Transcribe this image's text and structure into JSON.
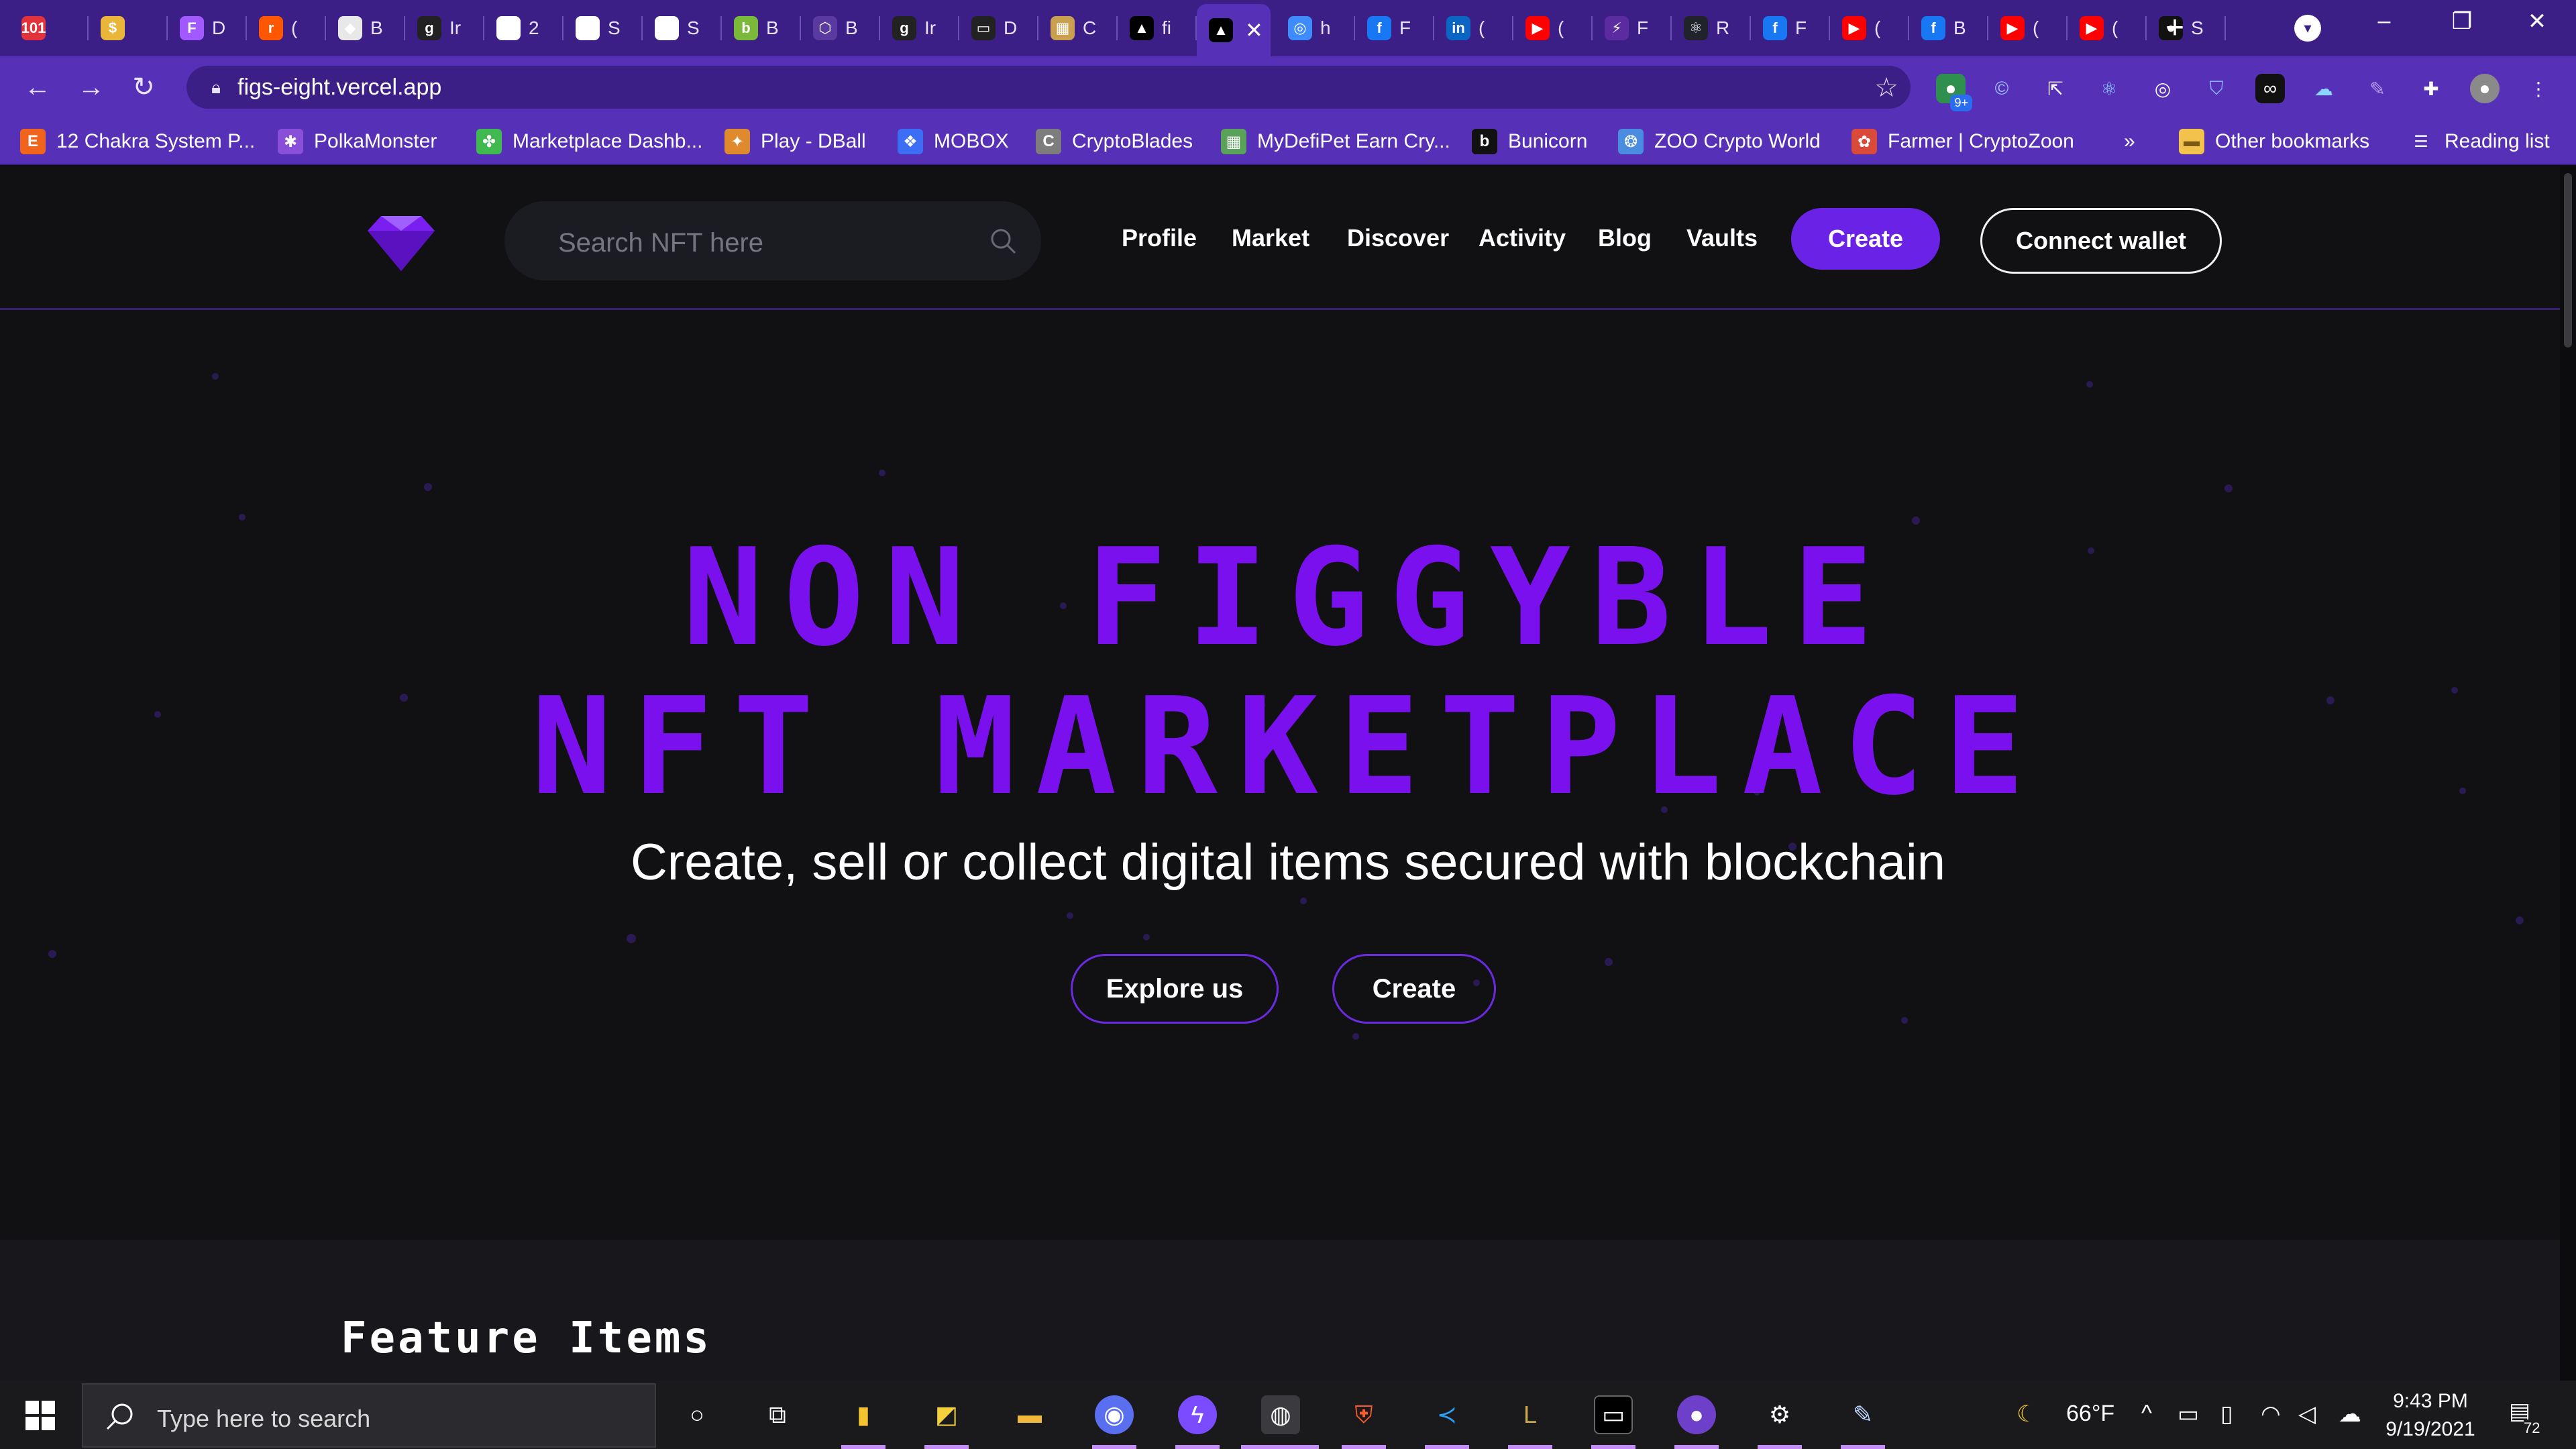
{
  "browser": {
    "tabs": [
      {
        "icon": "calendar-icon",
        "title": "",
        "color": "#e2323b",
        "glyph": "101"
      },
      {
        "icon": "bolt-icon",
        "title": "",
        "color": "#e9b63a",
        "glyph": "$"
      },
      {
        "icon": "figma-icon",
        "title": "D",
        "color": "#a259ff",
        "glyph": "F"
      },
      {
        "icon": "reddit-icon",
        "title": "(",
        "color": "#ff5700",
        "glyph": "r"
      },
      {
        "icon": "binance-icon",
        "title": "B",
        "color": "#e8e8e8",
        "glyph": "◆"
      },
      {
        "icon": "gitbook-icon",
        "title": "Ir",
        "color": "#222",
        "glyph": "g"
      },
      {
        "icon": "coin-icon",
        "title": "2",
        "color": "#fff",
        "glyph": "C"
      },
      {
        "icon": "coin-icon",
        "title": "S",
        "color": "#fff",
        "glyph": "C"
      },
      {
        "icon": "coin-icon",
        "title": "S",
        "color": "#fff",
        "glyph": "C"
      },
      {
        "icon": "leaf-icon",
        "title": "B",
        "color": "#7ab93a",
        "glyph": "b"
      },
      {
        "icon": "hex-icon",
        "title": "B",
        "color": "#5a3aa0",
        "glyph": "⬡"
      },
      {
        "icon": "gitbook-icon",
        "title": "Ir",
        "color": "#222",
        "glyph": "g"
      },
      {
        "icon": "vr-icon",
        "title": "D",
        "color": "#222",
        "glyph": "▭"
      },
      {
        "icon": "map-icon",
        "title": "C",
        "color": "#c9a050",
        "glyph": "▦"
      },
      {
        "icon": "triangle-icon",
        "title": "fi",
        "color": "#000",
        "glyph": "▲"
      },
      {
        "icon": "triangle-icon",
        "title": "",
        "color": "#000",
        "glyph": "▲",
        "active": true
      },
      {
        "icon": "globe-icon",
        "title": "h",
        "color": "#3d8bfd",
        "glyph": "◎"
      },
      {
        "icon": "facebook-icon",
        "title": "F",
        "color": "#1877f2",
        "glyph": "f"
      },
      {
        "icon": "linkedin-icon",
        "title": "(",
        "color": "#0a66c2",
        "glyph": "in"
      },
      {
        "icon": "youtube-icon",
        "title": "(",
        "color": "#ff0000",
        "glyph": "▶"
      },
      {
        "icon": "bolt-icon",
        "title": "F",
        "color": "#5b2ca0",
        "glyph": "⚡"
      },
      {
        "icon": "react-icon",
        "title": "R",
        "color": "#20232a",
        "glyph": "⚛"
      },
      {
        "icon": "facebook-icon",
        "title": "F",
        "color": "#1877f2",
        "glyph": "f"
      },
      {
        "icon": "youtube-icon",
        "title": "(",
        "color": "#ff0000",
        "glyph": "▶"
      },
      {
        "icon": "facebook-icon",
        "title": "B",
        "color": "#1877f2",
        "glyph": "f"
      },
      {
        "icon": "youtube-icon",
        "title": "(",
        "color": "#ff0000",
        "glyph": "▶"
      },
      {
        "icon": "youtube-icon",
        "title": "(",
        "color": "#ff0000",
        "glyph": "▶"
      },
      {
        "icon": "github-icon",
        "title": "S",
        "color": "#111",
        "glyph": "●"
      }
    ],
    "url": "figs-eight.vercel.app",
    "extensions_badge": "9+",
    "bookmarks": [
      {
        "label": "12 Chakra System P...",
        "icon": "etsy-icon",
        "color": "#f1641e",
        "glyph": "E"
      },
      {
        "label": "PolkaMonster",
        "icon": "monster-icon",
        "color": "#8a4fd8",
        "glyph": "✱"
      },
      {
        "label": "Marketplace Dashb...",
        "icon": "clover-icon",
        "color": "#3fb950",
        "glyph": "✤"
      },
      {
        "label": "Play - DBall",
        "icon": "dragon-icon",
        "color": "#e08a2e",
        "glyph": "✦"
      },
      {
        "label": "MOBOX",
        "icon": "mobox-icon",
        "color": "#3b6ef5",
        "glyph": "❖"
      },
      {
        "label": "CryptoBlades",
        "icon": "blade-icon",
        "color": "#7d7d7d",
        "glyph": "C"
      },
      {
        "label": "MyDefiPet Earn Cry...",
        "icon": "pet-icon",
        "color": "#5aa15a",
        "glyph": "▦"
      },
      {
        "label": "Bunicorn",
        "icon": "bunicorn-icon",
        "color": "#111",
        "glyph": "b"
      },
      {
        "label": "ZOO Crypto World",
        "icon": "paw-icon",
        "color": "#4a8de0",
        "glyph": "❂"
      },
      {
        "label": "Farmer | CryptoZoon",
        "icon": "farmer-icon",
        "color": "#d94a3a",
        "glyph": "✿"
      }
    ],
    "overflow": "»",
    "other_bookmarks": "Other bookmarks",
    "reading_list": "Reading list"
  },
  "site": {
    "search_placeholder": "Search NFT here",
    "nav": [
      "Profile",
      "Market",
      "Discover",
      "Activity",
      "Blog",
      "Vaults"
    ],
    "create_label": "Create",
    "connect_label": "Connect wallet",
    "hero_line1": "NON FIGGYBLE",
    "hero_line2": "NFT MARKETPLACE",
    "hero_sub": "Create, sell or collect digital items secured with blockchain",
    "explore_label": "Explore us",
    "hero_create_label": "Create",
    "features_title": "Feature Items",
    "accent": "#7a10ee"
  },
  "taskbar": {
    "search_placeholder": "Type here to search",
    "weather": "66°F",
    "time": "9:43 PM",
    "date": "9/19/2021",
    "notifications": "72"
  }
}
